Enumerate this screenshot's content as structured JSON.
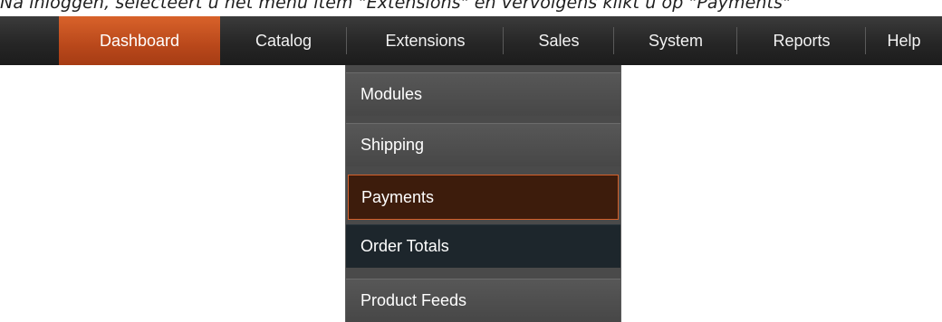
{
  "caption": "Na inloggen, selecteert u het menu item \"Extensions\" en vervolgens klikt u op \"Payments\"",
  "menubar": {
    "items": [
      {
        "label": "Dashboard"
      },
      {
        "label": "Catalog"
      },
      {
        "label": "Extensions"
      },
      {
        "label": "Sales"
      },
      {
        "label": "System"
      },
      {
        "label": "Reports"
      },
      {
        "label": "Help"
      }
    ]
  },
  "dropdown": {
    "items": [
      {
        "label": "Modules"
      },
      {
        "label": "Shipping"
      },
      {
        "label": "Payments"
      },
      {
        "label": "Order Totals"
      },
      {
        "label": "Product Feeds"
      }
    ]
  },
  "colors": {
    "accent": "#c0521f",
    "menubar": "#262626",
    "dropdown": "#4a4a4a",
    "selected_bg": "#3d1c0c",
    "hover_bg": "#1d262c"
  }
}
